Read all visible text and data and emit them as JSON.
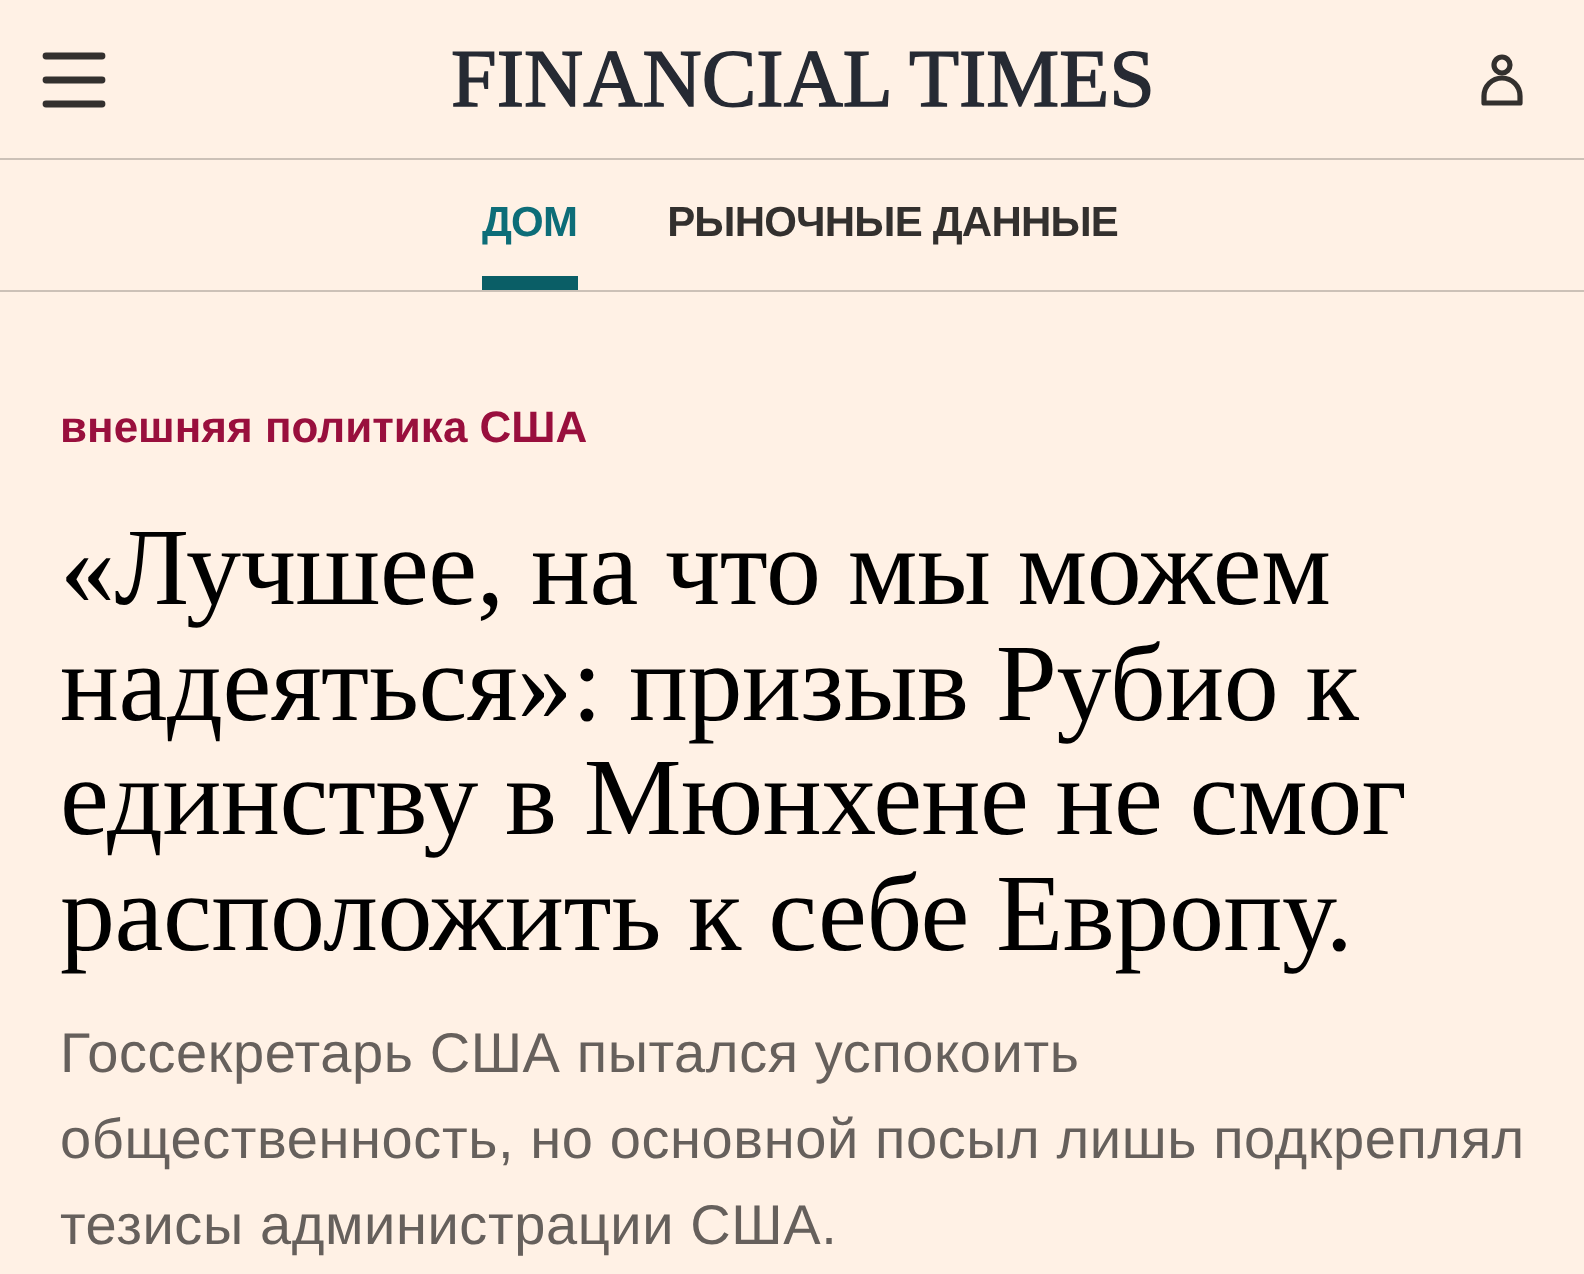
{
  "header": {
    "logo": "FINANCIAL TIMES"
  },
  "nav": {
    "tabs": [
      {
        "label": "ДОМ",
        "selected": true
      },
      {
        "label": "РЫНОЧНЫЕ ДАННЫЕ",
        "selected": false
      }
    ]
  },
  "article": {
    "category": "внешняя политика США",
    "headline": "«Лучшее, на что мы можем надеяться»: призыв Рубио к единству в Мюнхене не смог расположить к себе Европу.",
    "standfirst": "Госсекретарь США пытался успокоить общественность, но основной посыл лишь подкреплял тезисы администрации США."
  }
}
